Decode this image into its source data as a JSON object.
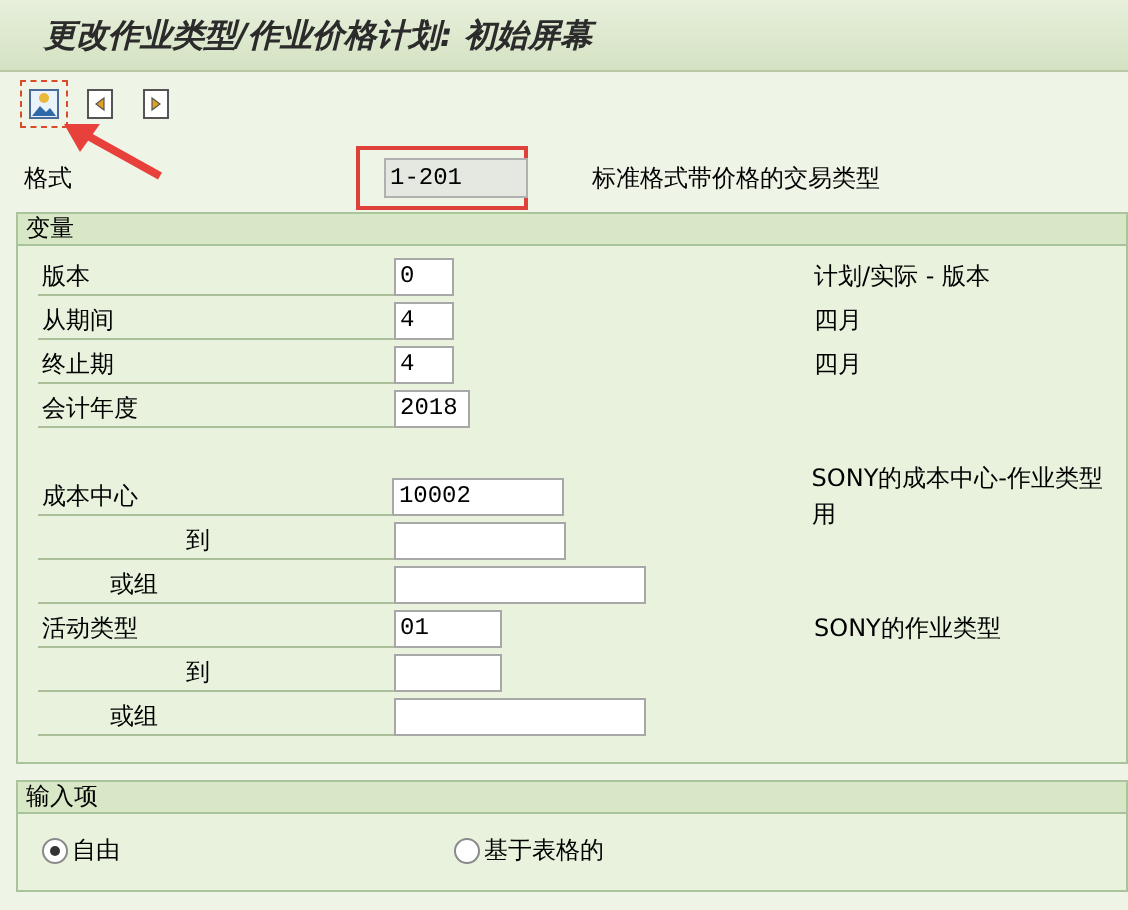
{
  "window": {
    "title": "更改作业类型/作业价格计划: 初始屏幕"
  },
  "format": {
    "label": "格式",
    "value": "1-201",
    "description": "标准格式带价格的交易类型",
    "highlighted": true
  },
  "variables": {
    "title": "变量",
    "sections": [
      [
        {
          "kind": "main",
          "label": "版本",
          "value": "0",
          "description": "计划/实际 - 版本"
        },
        {
          "kind": "main",
          "label": "从期间",
          "value": "4",
          "description": "四月"
        },
        {
          "kind": "main",
          "label": "终止期",
          "value": "4",
          "description": "四月"
        },
        {
          "kind": "main",
          "label": "会计年度",
          "value": "2018"
        }
      ],
      [
        {
          "kind": "main",
          "label": "成本中心",
          "value": "10002",
          "description": "SONY的成本中心-作业类型用"
        },
        {
          "kind": "to",
          "label": "到"
        },
        {
          "kind": "group",
          "label": "或组"
        },
        {
          "kind": "main",
          "label": "活动类型",
          "value": "01",
          "description": "SONY的作业类型"
        },
        {
          "kind": "to",
          "label": "到"
        },
        {
          "kind": "group",
          "label": "或组"
        }
      ]
    ]
  },
  "entry": {
    "title": "输入项",
    "options": [
      {
        "label": "自由",
        "selected": true
      },
      {
        "label": "基于表格的",
        "selected": false
      }
    ]
  }
}
